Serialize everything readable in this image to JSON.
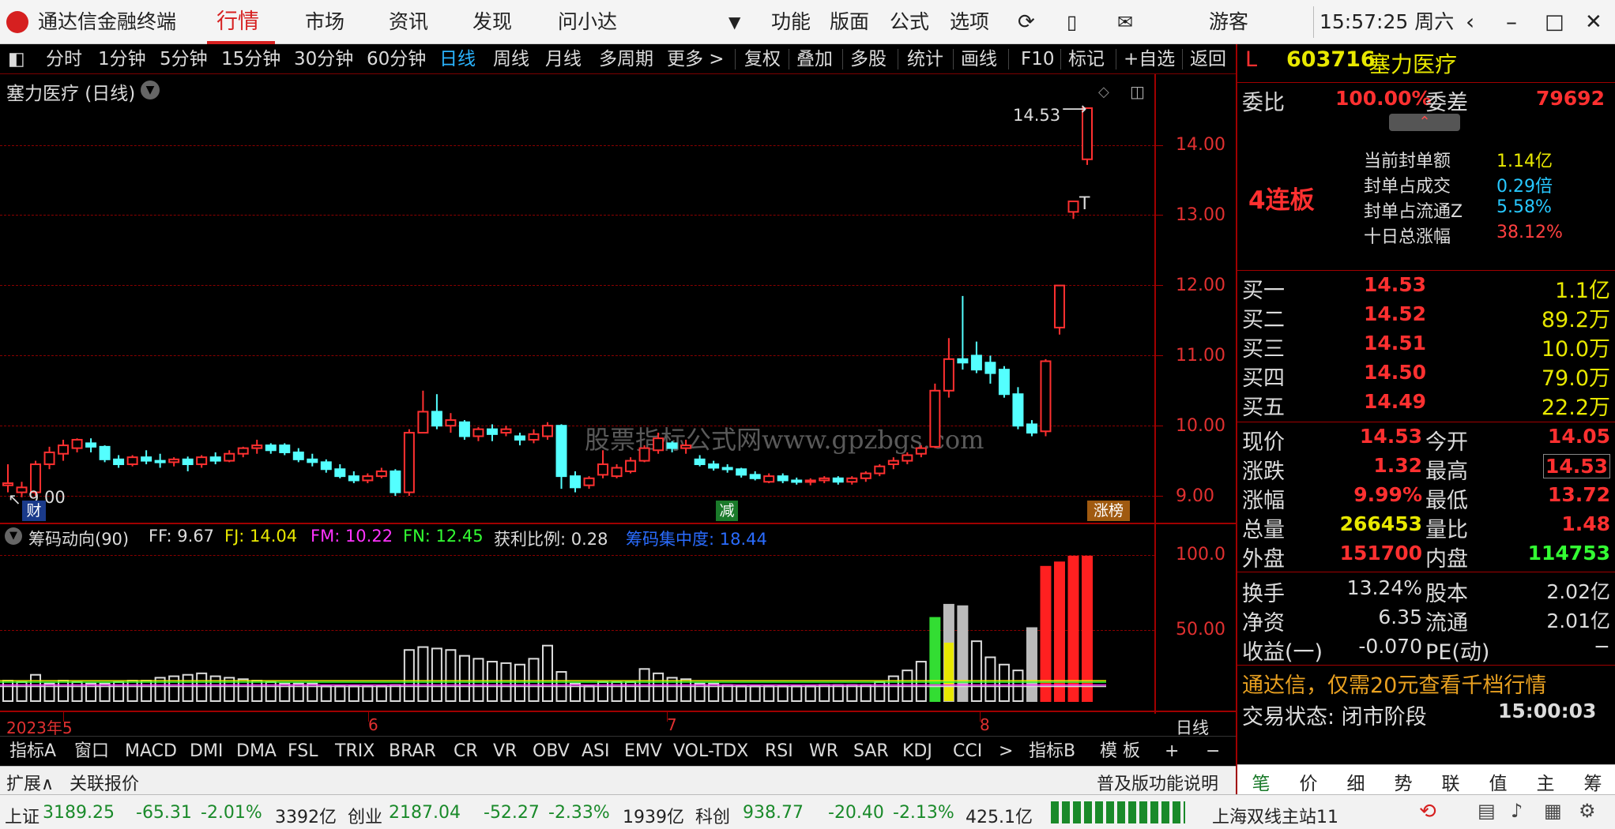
{
  "window": {
    "title": "通达信金融终端",
    "time": "15:57:25 周六",
    "user": "游客"
  },
  "nav": {
    "items": [
      "行情",
      "市场",
      "资讯",
      "发现",
      "问小达"
    ],
    "right_items": [
      "功能",
      "版面",
      "公式",
      "选项"
    ]
  },
  "period_bar": [
    "分时",
    "1分钟",
    "5分钟",
    "15分钟",
    "30分钟",
    "60分钟",
    "日线",
    "周线",
    "月线",
    "多周期",
    "更多 >"
  ],
  "tool_bar": [
    "复权",
    "叠加",
    "多股",
    "统计",
    "画线",
    "F10",
    "标记",
    "+自选",
    "返回"
  ],
  "chart": {
    "title": "塞力医疗 (日线)",
    "last_price_label": "14.53",
    "low_label": "9.00",
    "y_ticks": [
      "14.00",
      "13.00",
      "12.00",
      "11.00",
      "10.00",
      "9.00"
    ],
    "badges": {
      "cai": "财",
      "jian": "减",
      "zhangbang": "涨榜"
    },
    "watermark": "股票指标公式网www.gpzbgs.com",
    "cursor_mark": "T"
  },
  "indicator": {
    "name": "筹码动向(90)",
    "ff": "FF: 9.67",
    "fj": "FJ: 14.04",
    "fm": "FM: 10.22",
    "fn": "FN: 12.45",
    "profit": "获利比例: 0.28",
    "concentration": "筹码集中度: 18.44",
    "y_ticks": [
      "100.0",
      "50.00"
    ]
  },
  "x_axis": {
    "labels": [
      "2023年5",
      "6",
      "7",
      "8"
    ],
    "right_label": "日线"
  },
  "indicator_tabs": [
    "指标A",
    "窗口",
    "MACD",
    "DMI",
    "DMA",
    "FSL",
    "TRIX",
    "BRAR",
    "CR",
    "VR",
    "OBV",
    "ASI",
    "EMV",
    "VOL-TDX",
    "RSI",
    "WR",
    "SAR",
    "KDJ",
    "CCI",
    ">",
    "指标B",
    "模 板",
    "+",
    "−"
  ],
  "ext_bar": {
    "expand": "扩展∧",
    "related": "关联报价",
    "help": "普及版功能说明"
  },
  "right_tabs": [
    "笔",
    "价",
    "细",
    "势",
    "联",
    "值",
    "主",
    "筹"
  ],
  "stock": {
    "flag": "L",
    "code": "603716",
    "name": "塞力医疗"
  },
  "weibi": {
    "label1": "委比",
    "value1": "100.00%",
    "label2": "委差",
    "value2": "79692"
  },
  "limit": {
    "streak": "4连板",
    "rows": [
      {
        "label": "当前封单额",
        "value": "1.14亿",
        "color": "#e8e800"
      },
      {
        "label": "封单占成交",
        "value": "0.29倍",
        "color": "#27c8ff"
      },
      {
        "label": "封单占流通Z",
        "value": "5.58%",
        "color": "#27c8ff"
      },
      {
        "label": "十日总涨幅",
        "value": "38.12%",
        "color": "#ff4040"
      }
    ]
  },
  "bids": [
    {
      "label": "买一",
      "price": "14.53",
      "vol": "1.1亿"
    },
    {
      "label": "买二",
      "price": "14.52",
      "vol": "89.2万"
    },
    {
      "label": "买三",
      "price": "14.51",
      "vol": "10.0万"
    },
    {
      "label": "买四",
      "price": "14.50",
      "vol": "79.0万"
    },
    {
      "label": "买五",
      "price": "14.49",
      "vol": "22.2万"
    }
  ],
  "quote": [
    {
      "l1": "现价",
      "v1": "14.53",
      "c1": "#ff3030",
      "l2": "今开",
      "v2": "14.05",
      "c2": "#ff3030"
    },
    {
      "l1": "涨跌",
      "v1": "1.32",
      "c1": "#ff3030",
      "l2": "最高",
      "v2": "14.53",
      "c2": "#ff3030"
    },
    {
      "l1": "涨幅",
      "v1": "9.99%",
      "c1": "#ff3030",
      "l2": "最低",
      "v2": "13.72",
      "c2": "#ff3030"
    },
    {
      "l1": "总量",
      "v1": "266453",
      "c1": "#e8e800",
      "l2": "量比",
      "v2": "1.48",
      "c2": "#ff3030"
    },
    {
      "l1": "外盘",
      "v1": "151700",
      "c1": "#ff3030",
      "l2": "内盘",
      "v2": "114753",
      "c2": "#33ff33"
    }
  ],
  "fundamentals": [
    {
      "l1": "换手",
      "v1": "13.24%",
      "l2": "股本",
      "v2": "2.02亿"
    },
    {
      "l1": "净资",
      "v1": "6.35",
      "l2": "流通",
      "v2": "2.01亿"
    },
    {
      "l1": "收益(一)",
      "v1": "-0.070",
      "l2": "PE(动)",
      "v2": "−"
    }
  ],
  "promo": "通达信，仅需20元查看千档行情",
  "trade_status": {
    "label": "交易状态: 闭市阶段",
    "time": "15:00:03"
  },
  "status_bar": {
    "sh": {
      "name": "上证",
      "price": "3189.25",
      "chg": "-65.31",
      "pct": "-2.01%",
      "amt": "3392亿"
    },
    "cy": {
      "name": "创业",
      "price": "2187.04",
      "chg": "-52.27",
      "pct": "-2.33%",
      "amt": "1939亿"
    },
    "kc": {
      "name": "科创",
      "price": "938.77",
      "chg": "-20.40",
      "pct": "-2.13%",
      "amt": "425.1亿"
    },
    "server": "上海双线主站11"
  },
  "chart_data": {
    "type": "candlestick",
    "ylim": [
      8.6,
      14.9
    ],
    "ohlc": [
      [
        9.15,
        9.45,
        9.18,
        9.05
      ],
      [
        9.05,
        9.2,
        9.12,
        8.98
      ],
      [
        9.05,
        9.5,
        9.45,
        9.0
      ],
      [
        9.45,
        9.7,
        9.62,
        9.38
      ],
      [
        9.6,
        9.8,
        9.72,
        9.5
      ],
      [
        9.68,
        9.82,
        9.8,
        9.62
      ],
      [
        9.75,
        9.82,
        9.7,
        9.62
      ],
      [
        9.7,
        9.72,
        9.52,
        9.48
      ],
      [
        9.52,
        9.58,
        9.45,
        9.4
      ],
      [
        9.45,
        9.58,
        9.55,
        9.42
      ],
      [
        9.55,
        9.65,
        9.5,
        9.45
      ],
      [
        9.5,
        9.6,
        9.48,
        9.4
      ],
      [
        9.48,
        9.55,
        9.52,
        9.42
      ],
      [
        9.52,
        9.56,
        9.45,
        9.35
      ],
      [
        9.45,
        9.58,
        9.55,
        9.4
      ],
      [
        9.55,
        9.62,
        9.5,
        9.45
      ],
      [
        9.5,
        9.65,
        9.6,
        9.48
      ],
      [
        9.6,
        9.7,
        9.68,
        9.55
      ],
      [
        9.68,
        9.8,
        9.72,
        9.6
      ],
      [
        9.72,
        9.75,
        9.65,
        9.6
      ],
      [
        9.72,
        9.75,
        9.62,
        9.58
      ],
      [
        9.62,
        9.68,
        9.52,
        9.48
      ],
      [
        9.52,
        9.6,
        9.48,
        9.42
      ],
      [
        9.48,
        9.52,
        9.38,
        9.33
      ],
      [
        9.38,
        9.45,
        9.28,
        9.25
      ],
      [
        9.28,
        9.35,
        9.22,
        9.18
      ],
      [
        9.22,
        9.32,
        9.28,
        9.18
      ],
      [
        9.28,
        9.4,
        9.35,
        9.25
      ],
      [
        9.35,
        9.38,
        9.05,
        9.0
      ],
      [
        9.05,
        9.95,
        9.9,
        9.0
      ],
      [
        9.9,
        10.5,
        10.2,
        9.9
      ],
      [
        10.2,
        10.45,
        10.0,
        9.95
      ],
      [
        10.0,
        10.18,
        10.08,
        9.9
      ],
      [
        10.05,
        10.08,
        9.85,
        9.8
      ],
      [
        9.85,
        9.98,
        9.95,
        9.78
      ],
      [
        9.95,
        10.02,
        9.88,
        9.78
      ],
      [
        9.9,
        10.0,
        9.95,
        9.85
      ],
      [
        9.85,
        9.9,
        9.8,
        9.72
      ],
      [
        9.8,
        9.95,
        9.88,
        9.75
      ],
      [
        9.85,
        10.05,
        10.0,
        9.8
      ],
      [
        10.0,
        10.02,
        9.28,
        9.1
      ],
      [
        9.28,
        9.35,
        9.12,
        9.05
      ],
      [
        9.15,
        9.28,
        9.25,
        9.1
      ],
      [
        9.3,
        9.65,
        9.45,
        9.25
      ],
      [
        9.28,
        9.45,
        9.4,
        9.25
      ],
      [
        9.35,
        9.55,
        9.5,
        9.32
      ],
      [
        9.5,
        9.72,
        9.68,
        9.48
      ],
      [
        9.65,
        9.9,
        9.82,
        9.6
      ],
      [
        9.75,
        9.78,
        9.68,
        9.62
      ],
      [
        9.68,
        9.8,
        9.72,
        9.6
      ],
      [
        9.52,
        9.58,
        9.45,
        9.42
      ],
      [
        9.45,
        9.5,
        9.4,
        9.36
      ],
      [
        9.4,
        9.45,
        9.38,
        9.33
      ],
      [
        9.38,
        9.4,
        9.3,
        9.26
      ],
      [
        9.3,
        9.35,
        9.25,
        9.22
      ],
      [
        9.2,
        9.32,
        9.28,
        9.18
      ],
      [
        9.28,
        9.32,
        9.22,
        9.18
      ],
      [
        9.22,
        9.26,
        9.2,
        9.16
      ],
      [
        9.2,
        9.25,
        9.22,
        9.15
      ],
      [
        9.22,
        9.28,
        9.25,
        9.18
      ],
      [
        9.25,
        9.28,
        9.2,
        9.16
      ],
      [
        9.2,
        9.28,
        9.25,
        9.16
      ],
      [
        9.25,
        9.35,
        9.32,
        9.2
      ],
      [
        9.32,
        9.45,
        9.42,
        9.28
      ],
      [
        9.45,
        9.55,
        9.5,
        9.38
      ],
      [
        9.5,
        9.62,
        9.58,
        9.45
      ],
      [
        9.6,
        9.72,
        9.68,
        9.55
      ],
      [
        9.7,
        10.6,
        10.5,
        9.68
      ],
      [
        10.5,
        11.25,
        10.95,
        10.4
      ],
      [
        10.95,
        11.85,
        10.9,
        10.8
      ],
      [
        11.0,
        11.2,
        10.8,
        10.75
      ],
      [
        10.9,
        11.0,
        10.75,
        10.6
      ],
      [
        10.8,
        10.85,
        10.45,
        10.4
      ],
      [
        10.45,
        10.55,
        10.0,
        9.95
      ],
      [
        10.02,
        10.08,
        9.9,
        9.85
      ],
      [
        9.92,
        10.95,
        10.92,
        9.85
      ],
      [
        11.4,
        12.0,
        12.0,
        11.3
      ],
      [
        13.05,
        13.2,
        13.2,
        12.95
      ],
      [
        13.8,
        14.53,
        14.53,
        13.72
      ]
    ],
    "volume": [
      14,
      13,
      18,
      12,
      14,
      13,
      12,
      12,
      13,
      14,
      14,
      16,
      17,
      18,
      19,
      17,
      16,
      15,
      14,
      13,
      12,
      12,
      12,
      10,
      10,
      10,
      10,
      10,
      11,
      35,
      37,
      36,
      35,
      31,
      29,
      27,
      26,
      25,
      29,
      38,
      20,
      12,
      10,
      13,
      13,
      13,
      22,
      19,
      16,
      15,
      12,
      12,
      11,
      10,
      10,
      10,
      10,
      10,
      10,
      11,
      11,
      11,
      11,
      13,
      17,
      21,
      27,
      57,
      66,
      65,
      41,
      30,
      25,
      21,
      50,
      92,
      95,
      99,
      99
    ]
  }
}
